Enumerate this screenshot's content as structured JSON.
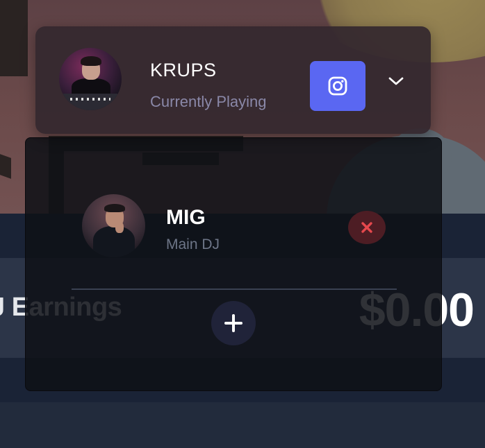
{
  "background": {
    "earnings_label": "J Earnings",
    "earnings_amount": "$0.00"
  },
  "now_playing": {
    "name": "KRUPS",
    "status": "Currently Playing",
    "avatar_icon": "dj-avatar-photo",
    "instagram_icon": "instagram-icon",
    "expand_icon": "chevron-down-icon",
    "accent": "#5a67f2"
  },
  "dj_list": {
    "items": [
      {
        "name": "MIG",
        "role": "Main DJ",
        "avatar_icon": "dj-avatar-photo",
        "remove_icon": "close-icon",
        "remove_color": "#e5484d"
      }
    ],
    "add_icon": "plus-icon"
  }
}
